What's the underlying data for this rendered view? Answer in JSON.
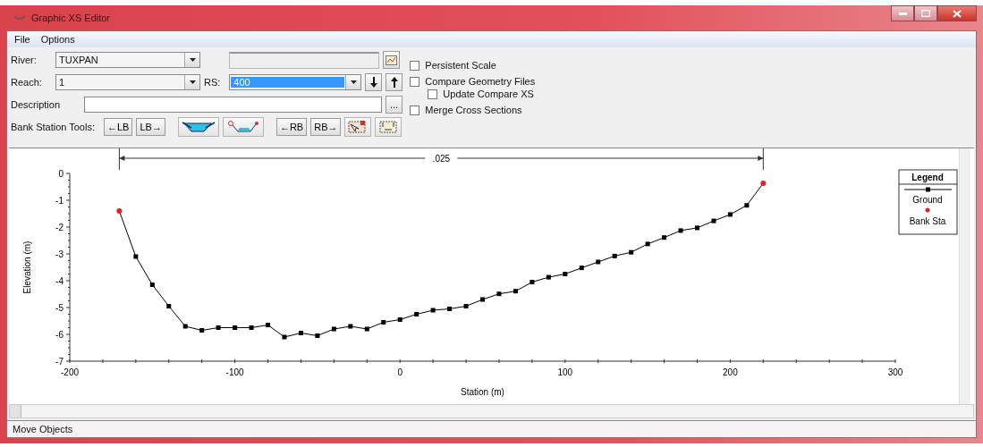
{
  "window": {
    "title": "Graphic XS Editor"
  },
  "menu": [
    {
      "label": "File"
    },
    {
      "label": "Options"
    }
  ],
  "form": {
    "river": {
      "label": "River:",
      "value": "TUXPAN"
    },
    "reach": {
      "label": "Reach:",
      "value": "1"
    },
    "rs": {
      "label": "RS:",
      "value": "400",
      "selected": true
    },
    "description": {
      "label": "Description"
    },
    "more_button": "...",
    "bank_tools": {
      "label": "Bank Station Tools:",
      "buttons": [
        {
          "kind": "text",
          "label": "←LB"
        },
        {
          "kind": "text",
          "label": "LB→"
        },
        {
          "kind": "fill"
        },
        {
          "kind": "drag"
        },
        {
          "kind": "text",
          "label": "←RB"
        },
        {
          "kind": "text",
          "label": "RB→"
        },
        {
          "kind": "select"
        },
        {
          "kind": "frame"
        }
      ]
    }
  },
  "options": [
    {
      "label": "Persistent Scale",
      "checked": false
    },
    {
      "label": "Compare Geometry Files",
      "checked": false,
      "children": [
        {
          "label": "Update Compare XS",
          "checked": false
        }
      ]
    },
    {
      "label": "Merge Cross Sections",
      "checked": false
    }
  ],
  "chart_data": {
    "type": "line",
    "xlabel": "Station (m)",
    "ylabel": "Elevation (m)",
    "x": [
      -170,
      -160,
      -150,
      -140,
      -130,
      -120,
      -110,
      -100,
      -90,
      -80,
      -70,
      -60,
      -50,
      -40,
      -30,
      -20,
      -10,
      0,
      10,
      20,
      30,
      40,
      50,
      60,
      70,
      80,
      90,
      100,
      110,
      120,
      130,
      140,
      150,
      160,
      170,
      180,
      190,
      200,
      210,
      220
    ],
    "series": [
      {
        "name": "Ground",
        "color": "#000000",
        "marker": "square",
        "values": [
          -1.4,
          -3.1,
          -4.15,
          -4.95,
          -5.7,
          -5.85,
          -5.75,
          -5.75,
          -5.75,
          -5.65,
          -6.1,
          -5.95,
          -6.05,
          -5.8,
          -5.7,
          -5.8,
          -5.55,
          -5.45,
          -5.25,
          -5.1,
          -5.05,
          -4.95,
          -4.7,
          -4.49,
          -4.39,
          -4.05,
          -3.87,
          -3.75,
          -3.52,
          -3.3,
          -3.08,
          -2.94,
          -2.63,
          -2.39,
          -2.13,
          -2.03,
          -1.77,
          -1.53,
          -1.19,
          -0.37
        ]
      },
      {
        "name": "Bank Sta",
        "color": "#e0202a",
        "type": "scatter",
        "marker": "circle",
        "values": [
          -1.4,
          null,
          null,
          null,
          null,
          null,
          null,
          null,
          null,
          null,
          null,
          null,
          null,
          null,
          null,
          null,
          null,
          null,
          null,
          null,
          null,
          null,
          null,
          null,
          null,
          null,
          null,
          null,
          null,
          null,
          null,
          null,
          null,
          null,
          null,
          null,
          null,
          null,
          null,
          -0.37
        ]
      }
    ],
    "xlim": [
      -200,
      300
    ],
    "ylim": [
      -7,
      0
    ],
    "xticks": [
      -200,
      -100,
      0,
      100,
      200,
      300
    ],
    "yticks": [
      0,
      -1,
      -2,
      -3,
      -4,
      -5,
      -6,
      -7
    ],
    "legend_title": "Legend",
    "annotations": [
      ".025"
    ]
  },
  "status_bar": "Move Objects"
}
